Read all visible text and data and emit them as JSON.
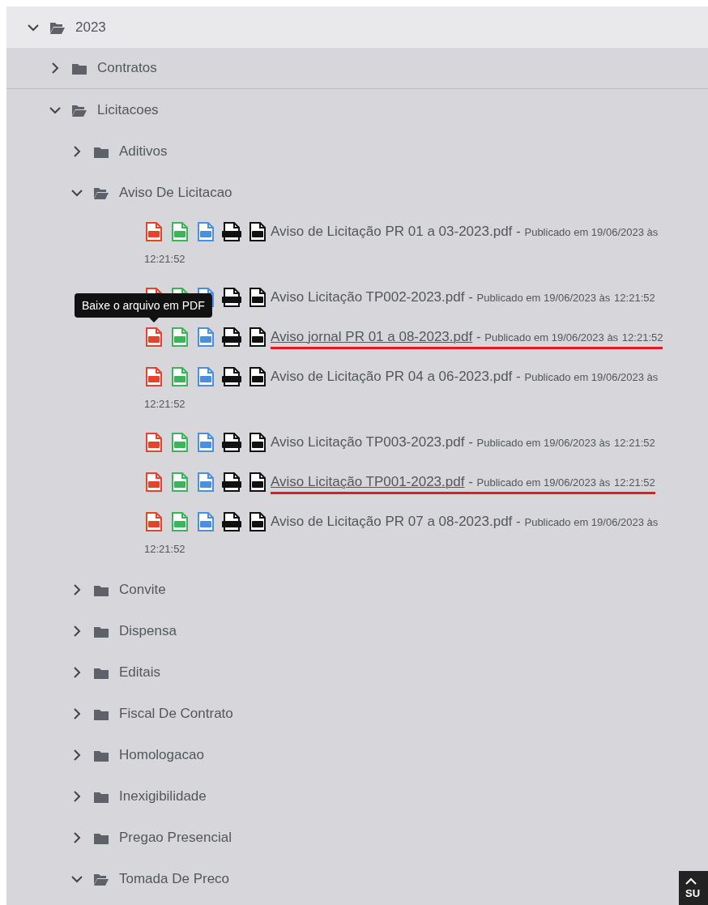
{
  "tree": [
    {
      "label": "2023",
      "expanded": true,
      "children": [
        {
          "label": "Contratos",
          "expanded": false
        },
        {
          "label": "Licitacoes",
          "expanded": true,
          "children": [
            {
              "label": "Aditivos",
              "expanded": false
            },
            {
              "label": "Aviso De Licitacao",
              "expanded": true,
              "files": [
                {
                  "name": "Aviso de Licitação PR 01 a 03-2023.pdf",
                  "separator": "-",
                  "date": "Publicado em 19/06/2023 às",
                  "time": "12:21:52",
                  "underlined": false
                },
                {
                  "name": "Aviso Licitação TP002-2023.pdf",
                  "separator": "-",
                  "date": "Publicado em 19/06/2023 às",
                  "time": "12:21:52",
                  "underlined": false
                },
                {
                  "name": "Aviso jornal PR 01 a 08-2023.pdf",
                  "separator": "-",
                  "date": "Publicado em 19/06/2023 às",
                  "time": "12:21:52",
                  "underlined": true,
                  "tooltip": "Baixe o arquivo em PDF"
                },
                {
                  "name": "Aviso de Licitação PR 04 a 06-2023.pdf",
                  "separator": "-",
                  "date": "Publicado em 19/06/2023 às",
                  "time": "12:21:52",
                  "underlined": false
                },
                {
                  "name": "Aviso Licitação TP003-2023.pdf",
                  "separator": "-",
                  "date": "Publicado em 19/06/2023 às",
                  "time": "12:21:52",
                  "underlined": false
                },
                {
                  "name": "Aviso Licitação TP001-2023.pdf",
                  "separator": "-",
                  "date": "Publicado em 19/06/2023 às",
                  "time": "12:21:52",
                  "underlined": true
                },
                {
                  "name": "Aviso de Licitação PR 07 a 08-2023.pdf",
                  "separator": "-",
                  "date": "Publicado em 19/06/2023 às",
                  "time": "12:21:52",
                  "underlined": false
                }
              ]
            },
            {
              "label": "Convite",
              "expanded": false
            },
            {
              "label": "Dispensa",
              "expanded": false
            },
            {
              "label": "Editais",
              "expanded": false
            },
            {
              "label": "Fiscal De Contrato",
              "expanded": false
            },
            {
              "label": "Homologacao",
              "expanded": false
            },
            {
              "label": "Inexigibilidade",
              "expanded": false
            },
            {
              "label": "Pregao Presencial",
              "expanded": false
            },
            {
              "label": "Tomada De Preco",
              "expanded": true
            }
          ]
        }
      ]
    }
  ],
  "back_to_top": {
    "label": "SU"
  }
}
